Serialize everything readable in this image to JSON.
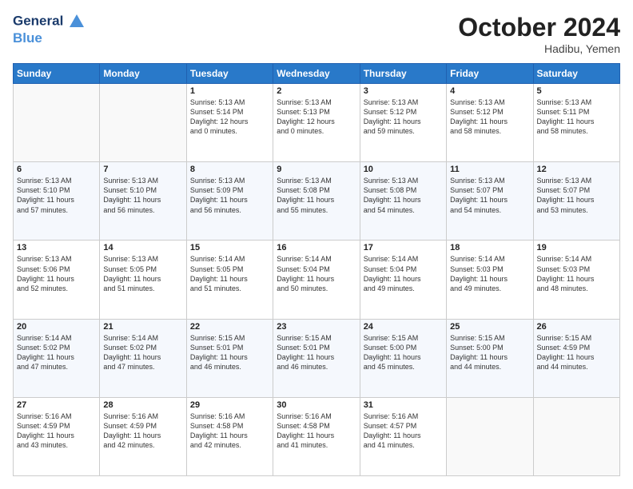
{
  "logo": {
    "line1": "General",
    "line2": "Blue"
  },
  "title": "October 2024",
  "location": "Hadibu, Yemen",
  "days_of_week": [
    "Sunday",
    "Monday",
    "Tuesday",
    "Wednesday",
    "Thursday",
    "Friday",
    "Saturday"
  ],
  "weeks": [
    [
      {
        "day": "",
        "content": ""
      },
      {
        "day": "",
        "content": ""
      },
      {
        "day": "1",
        "content": "Sunrise: 5:13 AM\nSunset: 5:14 PM\nDaylight: 12 hours\nand 0 minutes."
      },
      {
        "day": "2",
        "content": "Sunrise: 5:13 AM\nSunset: 5:13 PM\nDaylight: 12 hours\nand 0 minutes."
      },
      {
        "day": "3",
        "content": "Sunrise: 5:13 AM\nSunset: 5:12 PM\nDaylight: 11 hours\nand 59 minutes."
      },
      {
        "day": "4",
        "content": "Sunrise: 5:13 AM\nSunset: 5:12 PM\nDaylight: 11 hours\nand 58 minutes."
      },
      {
        "day": "5",
        "content": "Sunrise: 5:13 AM\nSunset: 5:11 PM\nDaylight: 11 hours\nand 58 minutes."
      }
    ],
    [
      {
        "day": "6",
        "content": "Sunrise: 5:13 AM\nSunset: 5:10 PM\nDaylight: 11 hours\nand 57 minutes."
      },
      {
        "day": "7",
        "content": "Sunrise: 5:13 AM\nSunset: 5:10 PM\nDaylight: 11 hours\nand 56 minutes."
      },
      {
        "day": "8",
        "content": "Sunrise: 5:13 AM\nSunset: 5:09 PM\nDaylight: 11 hours\nand 56 minutes."
      },
      {
        "day": "9",
        "content": "Sunrise: 5:13 AM\nSunset: 5:08 PM\nDaylight: 11 hours\nand 55 minutes."
      },
      {
        "day": "10",
        "content": "Sunrise: 5:13 AM\nSunset: 5:08 PM\nDaylight: 11 hours\nand 54 minutes."
      },
      {
        "day": "11",
        "content": "Sunrise: 5:13 AM\nSunset: 5:07 PM\nDaylight: 11 hours\nand 54 minutes."
      },
      {
        "day": "12",
        "content": "Sunrise: 5:13 AM\nSunset: 5:07 PM\nDaylight: 11 hours\nand 53 minutes."
      }
    ],
    [
      {
        "day": "13",
        "content": "Sunrise: 5:13 AM\nSunset: 5:06 PM\nDaylight: 11 hours\nand 52 minutes."
      },
      {
        "day": "14",
        "content": "Sunrise: 5:13 AM\nSunset: 5:05 PM\nDaylight: 11 hours\nand 51 minutes."
      },
      {
        "day": "15",
        "content": "Sunrise: 5:14 AM\nSunset: 5:05 PM\nDaylight: 11 hours\nand 51 minutes."
      },
      {
        "day": "16",
        "content": "Sunrise: 5:14 AM\nSunset: 5:04 PM\nDaylight: 11 hours\nand 50 minutes."
      },
      {
        "day": "17",
        "content": "Sunrise: 5:14 AM\nSunset: 5:04 PM\nDaylight: 11 hours\nand 49 minutes."
      },
      {
        "day": "18",
        "content": "Sunrise: 5:14 AM\nSunset: 5:03 PM\nDaylight: 11 hours\nand 49 minutes."
      },
      {
        "day": "19",
        "content": "Sunrise: 5:14 AM\nSunset: 5:03 PM\nDaylight: 11 hours\nand 48 minutes."
      }
    ],
    [
      {
        "day": "20",
        "content": "Sunrise: 5:14 AM\nSunset: 5:02 PM\nDaylight: 11 hours\nand 47 minutes."
      },
      {
        "day": "21",
        "content": "Sunrise: 5:14 AM\nSunset: 5:02 PM\nDaylight: 11 hours\nand 47 minutes."
      },
      {
        "day": "22",
        "content": "Sunrise: 5:15 AM\nSunset: 5:01 PM\nDaylight: 11 hours\nand 46 minutes."
      },
      {
        "day": "23",
        "content": "Sunrise: 5:15 AM\nSunset: 5:01 PM\nDaylight: 11 hours\nand 46 minutes."
      },
      {
        "day": "24",
        "content": "Sunrise: 5:15 AM\nSunset: 5:00 PM\nDaylight: 11 hours\nand 45 minutes."
      },
      {
        "day": "25",
        "content": "Sunrise: 5:15 AM\nSunset: 5:00 PM\nDaylight: 11 hours\nand 44 minutes."
      },
      {
        "day": "26",
        "content": "Sunrise: 5:15 AM\nSunset: 4:59 PM\nDaylight: 11 hours\nand 44 minutes."
      }
    ],
    [
      {
        "day": "27",
        "content": "Sunrise: 5:16 AM\nSunset: 4:59 PM\nDaylight: 11 hours\nand 43 minutes."
      },
      {
        "day": "28",
        "content": "Sunrise: 5:16 AM\nSunset: 4:59 PM\nDaylight: 11 hours\nand 42 minutes."
      },
      {
        "day": "29",
        "content": "Sunrise: 5:16 AM\nSunset: 4:58 PM\nDaylight: 11 hours\nand 42 minutes."
      },
      {
        "day": "30",
        "content": "Sunrise: 5:16 AM\nSunset: 4:58 PM\nDaylight: 11 hours\nand 41 minutes."
      },
      {
        "day": "31",
        "content": "Sunrise: 5:16 AM\nSunset: 4:57 PM\nDaylight: 11 hours\nand 41 minutes."
      },
      {
        "day": "",
        "content": ""
      },
      {
        "day": "",
        "content": ""
      }
    ]
  ]
}
